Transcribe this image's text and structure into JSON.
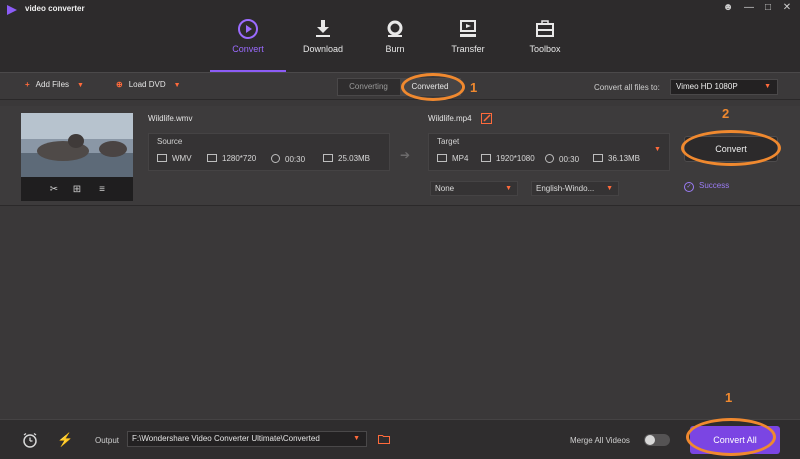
{
  "app": {
    "title": "video converter"
  },
  "window": {
    "minimize_glyph": "—",
    "maximize_glyph": "□",
    "close_glyph": "✕"
  },
  "nav": {
    "tabs": [
      {
        "label": "Convert",
        "icon": "convert-icon",
        "active": true
      },
      {
        "label": "Download",
        "icon": "download-icon"
      },
      {
        "label": "Burn",
        "icon": "burn-icon"
      },
      {
        "label": "Transfer",
        "icon": "transfer-icon"
      },
      {
        "label": "Toolbox",
        "icon": "toolbox-icon"
      }
    ]
  },
  "toolbar": {
    "add_files": "Add Files",
    "load_dvd": "Load DVD",
    "tab_converting": "Converting",
    "tab_converted": "Converted",
    "convert_all_to_label": "Convert all files to:",
    "preset_value": "Vimeo HD 1080P"
  },
  "file": {
    "source_name": "Wildlife.wmv",
    "source_label": "Source",
    "source": {
      "format": "WMV",
      "resolution": "1280*720",
      "duration": "00:30",
      "size": "25.03MB"
    },
    "target_name": "Wildlife.mp4",
    "target_label": "Target",
    "target": {
      "format": "MP4",
      "resolution": "1920*1080",
      "duration": "00:30",
      "size": "36.13MB"
    },
    "subtitle_option": "None",
    "audio_option": "English-Windo...",
    "convert_label": "Convert",
    "status": "Success"
  },
  "bottom": {
    "output_label": "Output",
    "output_path": "F:\\Wondershare Video Converter Ultimate\\Converted",
    "merge_label": "Merge All Videos",
    "merge_on": false,
    "convert_all": "Convert All"
  },
  "annotations": {
    "n1": "1",
    "n2": "2",
    "n3": "1"
  },
  "colors": {
    "accent": "#8c5cf6",
    "orange": "#ff6a3b",
    "annotation": "#f0892f"
  }
}
